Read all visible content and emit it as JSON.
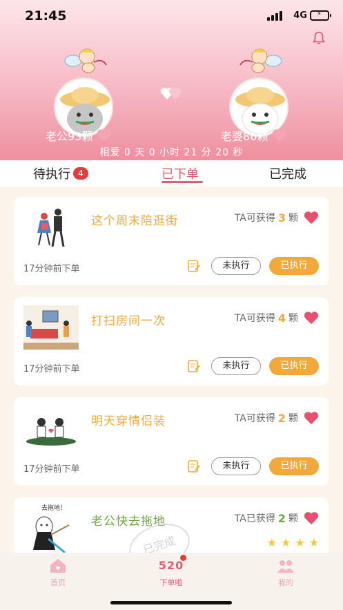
{
  "status": {
    "time": "21:45",
    "network": "4G"
  },
  "couple": {
    "husband_label": "老公93颗",
    "wife_label": "老婆86颗",
    "timer": "相爱 0 天 0 小时 21 分 20 秒"
  },
  "tabs": [
    {
      "label": "待执行",
      "badge": "4"
    },
    {
      "label": "已下单"
    },
    {
      "label": "已完成"
    }
  ],
  "orders": [
    {
      "title": "这个周末陪逛街",
      "gain_prefix": "TA可获得",
      "gain_num": "3",
      "gain_unit": "颗",
      "ago": "17分钟前下单",
      "btn_wait": "未执行",
      "btn_done": "已执行"
    },
    {
      "title": "打扫房间一次",
      "gain_prefix": "TA可获得",
      "gain_num": "4",
      "gain_unit": "颗",
      "ago": "17分钟前下单",
      "btn_wait": "未执行",
      "btn_done": "已执行"
    },
    {
      "title": "明天穿情侣装",
      "gain_prefix": "TA可获得",
      "gain_num": "2",
      "gain_unit": "颗",
      "ago": "17分钟前下单",
      "btn_wait": "未执行",
      "btn_done": "已执行"
    },
    {
      "title": "老公快去拖地",
      "gain_prefix": "TA已获得",
      "gain_num": "2",
      "gain_unit": "颗",
      "thumb_caption": "去拖地！",
      "stamp": "已完成",
      "rating": 4
    }
  ],
  "bottom_nav": [
    {
      "label": "首页"
    },
    {
      "label": "下单啦",
      "icon_text": "520"
    },
    {
      "label": "我的"
    }
  ],
  "colors": {
    "accent": "#e45b74",
    "orange": "#f0a93a",
    "green": "#6ea83c"
  }
}
